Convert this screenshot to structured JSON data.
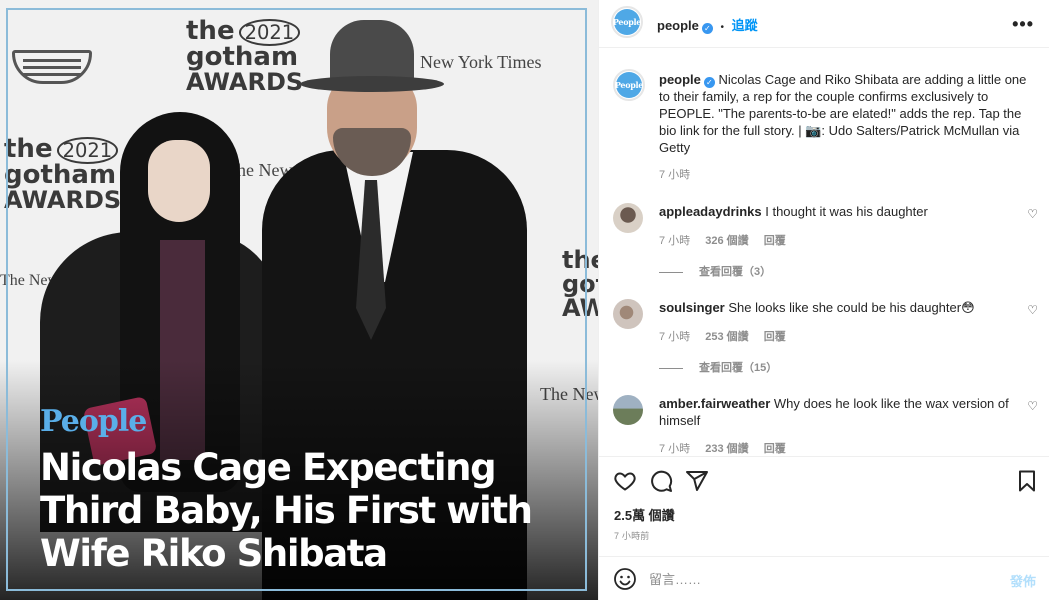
{
  "image": {
    "backdrop": {
      "the": "the",
      "year": "2021",
      "gotham": "gotham",
      "awards": "AWARDS",
      "nyt": "The New York Times",
      "nyt_short": "New York Times"
    },
    "brand": "People",
    "headline": "Nicolas Cage Expecting Third Baby, His First with Wife Riko Shibata"
  },
  "header": {
    "avatar_text": "People",
    "username": "people",
    "separator": "•",
    "follow": "追蹤",
    "more": "•••"
  },
  "caption": {
    "username": "people",
    "text": "Nicolas Cage and Riko Shibata are adding a little one to their family, a rep for the couple confirms exclusively to PEOPLE. \"The parents-to-be are elated!\" adds the rep. Tap the bio link for the full story. | 📷: Udo Salters/Patrick McMullan via Getty",
    "time": "7 小時"
  },
  "comments": [
    {
      "username": "appleadaydrinks",
      "text": "I thought it was his daughter",
      "time": "7 小時",
      "likes": "326 個讚",
      "reply": "回覆",
      "view_replies": "查看回覆（3）"
    },
    {
      "username": "soulsinger",
      "text": "She looks like she could be his daughter😳",
      "time": "7 小時",
      "likes": "253 個讚",
      "reply": "回覆",
      "view_replies": "查看回覆（15）"
    },
    {
      "username": "amber.fairweather",
      "text": "Why does he look like the wax version of himself",
      "time": "7 小時",
      "likes": "233 個讚",
      "reply": "回覆"
    }
  ],
  "actions": {
    "likes": "2.5萬 個讚",
    "time": "7 小時前"
  },
  "comment_box": {
    "placeholder": "留言……",
    "post": "發佈"
  },
  "colors": {
    "accent": "#0095f6",
    "verified": "#3897f0",
    "people_brand": "#4fa8e6",
    "muted": "#8e8e8e"
  }
}
